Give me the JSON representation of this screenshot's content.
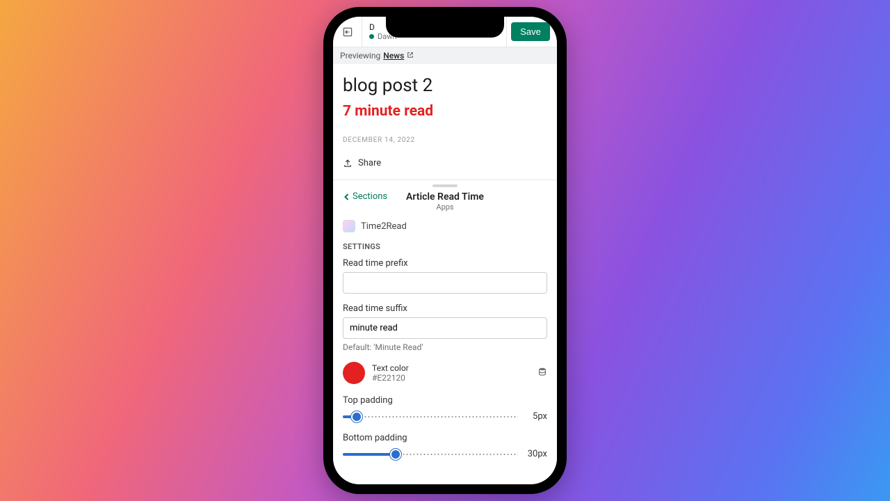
{
  "topbar": {
    "truncated_title": "D",
    "theme": "Dawn",
    "save_label": "Save"
  },
  "preview": {
    "prefix": "Previewing",
    "link": "News"
  },
  "post": {
    "title": "blog post 2",
    "read_time": "7 minute read",
    "date": "DECEMBER 14, 2022",
    "share": "Share"
  },
  "panel": {
    "back": "Sections",
    "title": "Article Read Time",
    "subtitle": "Apps",
    "app_name": "Time2Read"
  },
  "settings": {
    "heading": "SETTINGS",
    "prefix_label": "Read time prefix",
    "prefix_value": "",
    "suffix_label": "Read time suffix",
    "suffix_value": "minute read",
    "suffix_help": "Default: 'Minute Read'",
    "color_label": "Text color",
    "color_value": "#E22120",
    "top_pad_label": "Top padding",
    "top_pad_value": "5px",
    "bot_pad_label": "Bottom padding",
    "bot_pad_value": "30px"
  }
}
